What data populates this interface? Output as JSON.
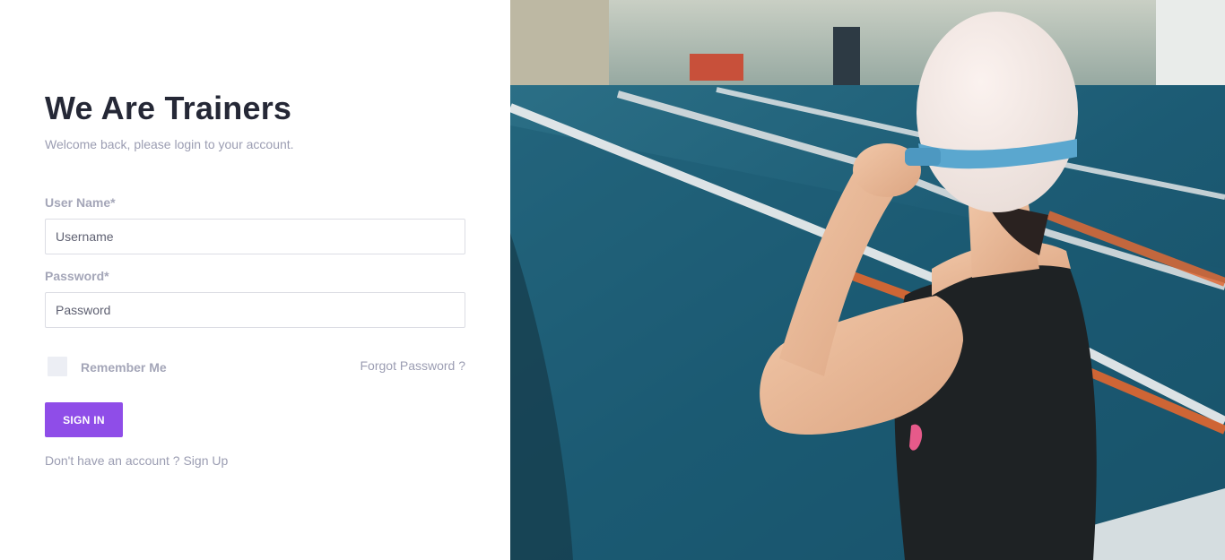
{
  "login": {
    "title": "We Are Trainers",
    "subtitle": "Welcome back, please login to your account.",
    "username_label": "User Name*",
    "username_placeholder": "Username",
    "username_value": "",
    "password_label": "Password*",
    "password_placeholder": "Password",
    "password_value": "",
    "remember_label": "Remember Me",
    "remember_checked": false,
    "forgot_label": "Forgot Password ?",
    "signin_label": "SIGN IN",
    "no_account_text": "Don't have an account ?",
    "signup_label": "Sign Up"
  },
  "colors": {
    "accent": "#8f4de8",
    "title": "#252836",
    "muted": "#9b9db2"
  },
  "hero": {
    "image_subject": "swimmer-at-pool-photo"
  }
}
